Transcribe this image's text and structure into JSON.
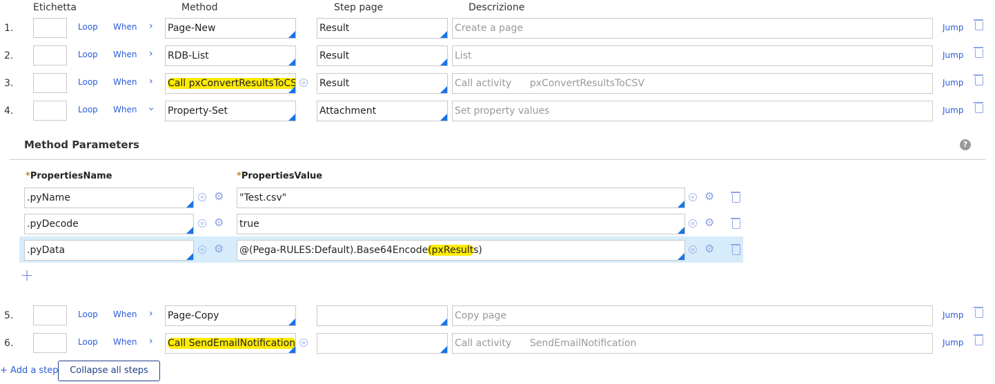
{
  "headers": {
    "label": "Etichetta",
    "method": "Method",
    "step_page": "Step page",
    "description": "Descrizione"
  },
  "step_links": {
    "loop": "Loop",
    "when": "When",
    "jump": "Jump"
  },
  "steps": [
    {
      "num": "1.",
      "method": "Page-New",
      "step_page": "Result",
      "description": "Create a page"
    },
    {
      "num": "2.",
      "method": "RDB-List",
      "step_page": "Result",
      "description": "List"
    },
    {
      "num": "3.",
      "method": "Call pxConvertResultsToCSV",
      "step_page": "Result",
      "description": "Call activity      pxConvertResultsToCSV"
    },
    {
      "num": "4.",
      "method": "Property-Set",
      "step_page": "Attachment",
      "description": "Set property values"
    },
    {
      "num": "5.",
      "method": "Page-Copy",
      "step_page": "",
      "description": "Copy page"
    },
    {
      "num": "6.",
      "method": "Call SendEmailNotification",
      "step_page": "",
      "description": "Call activity      SendEmailNotification"
    }
  ],
  "method_parameters": {
    "title": "Method Parameters",
    "help_icon": "?",
    "col_name": "PropertiesName",
    "col_value": "PropertiesValue",
    "required_mark": "*",
    "rows": [
      {
        "name": ".pyName",
        "value": "\"Test.csv\""
      },
      {
        "name": ".pyDecode",
        "value": "true"
      },
      {
        "name": ".pyData",
        "value_pre": "@(Pega-RULES:Default).Base64Encode",
        "value_hl": "(pxResult",
        "value_post": "s)"
      }
    ],
    "add_icon": "+"
  },
  "footer": {
    "add_step": "+ Add a step",
    "collapse": "Collapse all steps"
  },
  "colors": {
    "accent": "#1a73e8",
    "link": "#2a5bd7",
    "highlight": "#ffeb00",
    "selected_row": "#d6ecfa"
  }
}
